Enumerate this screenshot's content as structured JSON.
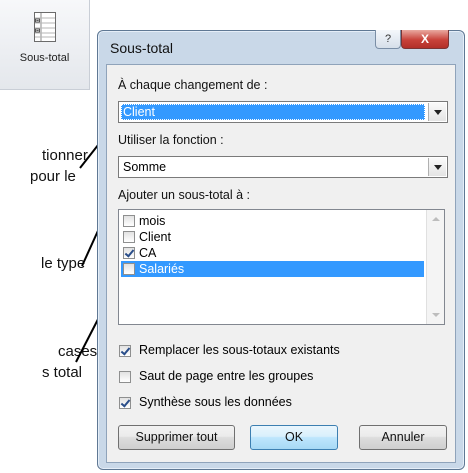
{
  "ribbon": {
    "icon": "subtotal-grid-icon",
    "label": "Sous-total"
  },
  "annotations": [
    "tionner",
    "pour le",
    "le type",
    "cases",
    "s total"
  ],
  "dialog": {
    "title": "Sous-total",
    "help_label": "?",
    "close_label": "X",
    "group_by_label": "À chaque changement de :",
    "group_by_value": "Client",
    "function_label": "Utiliser la fonction :",
    "function_value": "Somme",
    "add_subtotal_label": "Ajouter un sous-total à :",
    "columns": [
      {
        "label": "mois",
        "checked": false,
        "selected": false
      },
      {
        "label": "Client",
        "checked": false,
        "selected": false
      },
      {
        "label": "CA",
        "checked": true,
        "selected": false
      },
      {
        "label": "Salariés",
        "checked": false,
        "selected": true
      }
    ],
    "replace_label": "Remplacer les sous-totaux existants",
    "replace_checked": true,
    "page_break_label": "Saut de page entre les groupes",
    "page_break_checked": false,
    "summary_below_label": "Synthèse sous les données",
    "summary_below_checked": true,
    "remove_all_label": "Supprimer tout",
    "ok_label": "OK",
    "cancel_label": "Annuler"
  },
  "colors": {
    "selection": "#3399ff",
    "dialog_frame": "#c9d8e8",
    "close_button": "#c8423a"
  }
}
